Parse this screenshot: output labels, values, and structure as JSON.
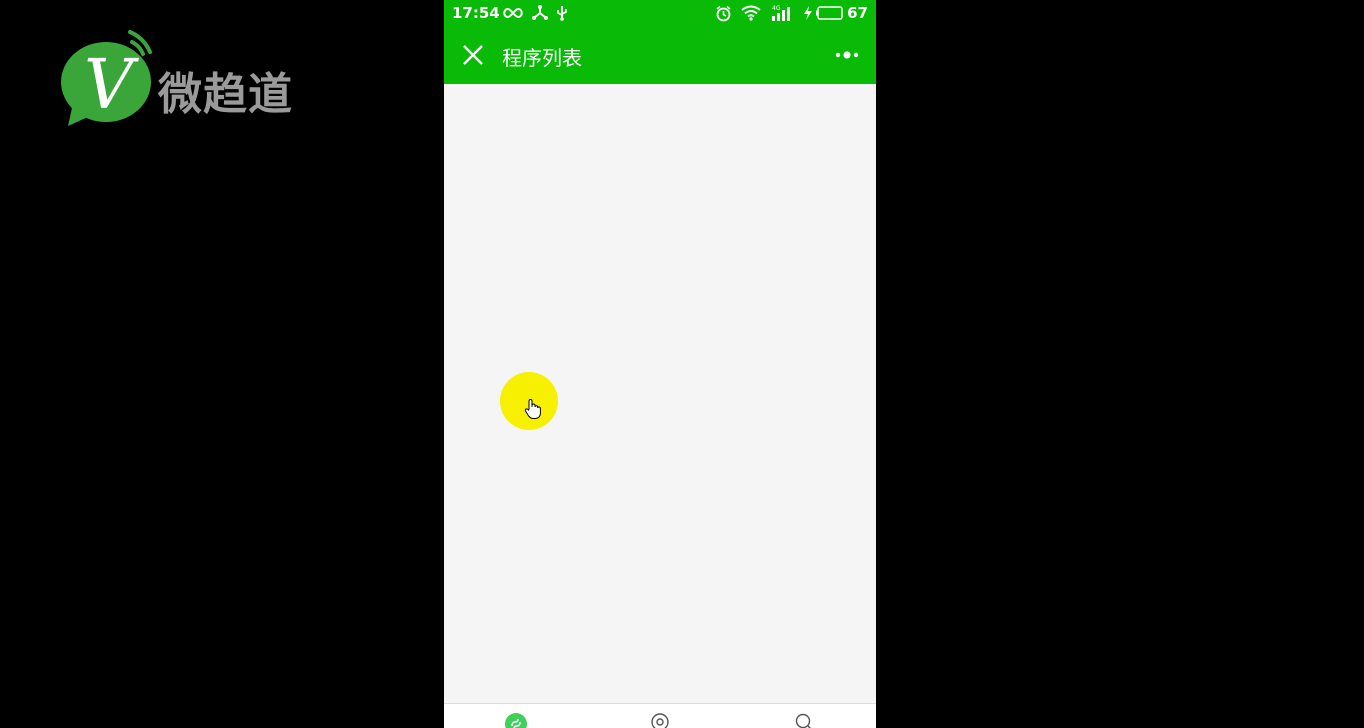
{
  "watermark": {
    "logo_text": "微趋道",
    "logo_letter": "V",
    "brand_green": "#3aa63a"
  },
  "statusbar": {
    "time": "17:54",
    "battery_percent": "67",
    "network_label": "4G",
    "left_icons": [
      "infinity-icon",
      "share-icon",
      "usb-icon"
    ],
    "right_icons": [
      "alarm-icon",
      "wifi-icon",
      "signal-icon",
      "charging-icon",
      "battery-icon"
    ]
  },
  "navbar": {
    "title": "程序列表",
    "close_icon": "close-icon",
    "more_icon": "more-dots-icon",
    "bg_color": "#09bb07"
  },
  "content": {
    "bg_color": "#f5f5f5",
    "tap_indicator_color": "#f7f000"
  },
  "tabbar": {
    "tabs": [
      {
        "icon": "miniprogram-icon",
        "active": true
      },
      {
        "icon": "discover-icon",
        "active": false
      },
      {
        "icon": "search-icon",
        "active": false
      }
    ]
  }
}
